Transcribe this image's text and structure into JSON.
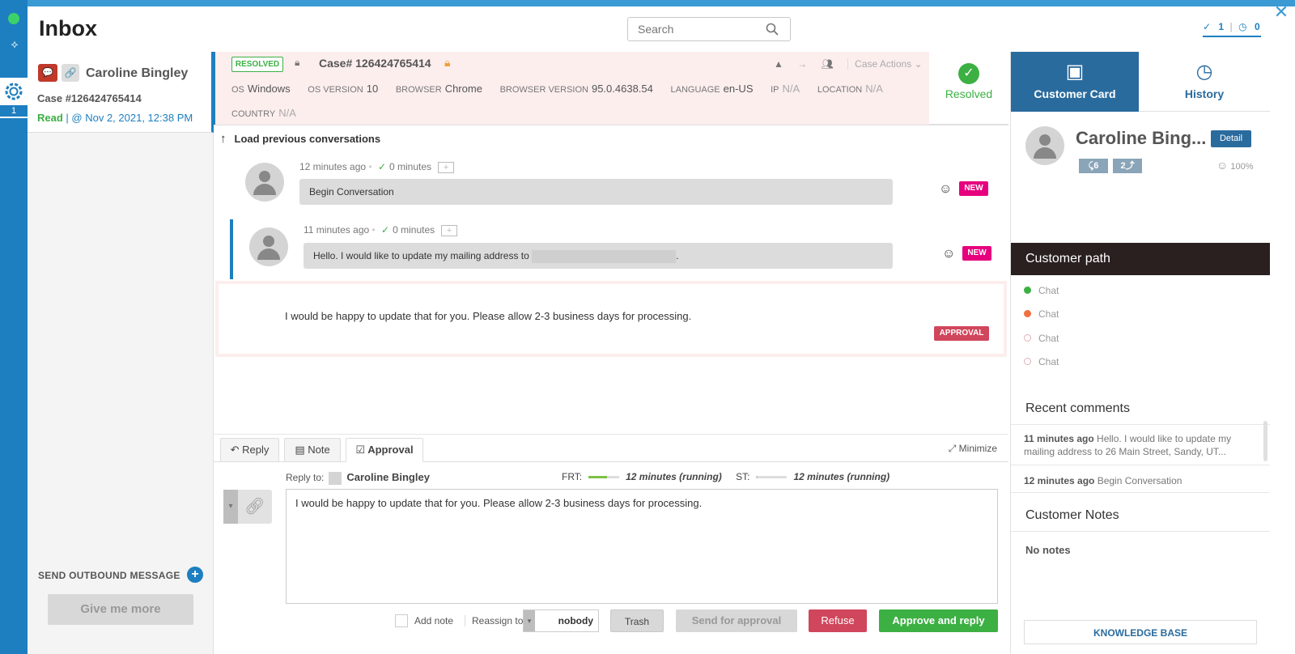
{
  "app": {
    "title": "Inbox",
    "close_glyph": "✕"
  },
  "rail": {
    "count": "1"
  },
  "search": {
    "placeholder": "Search"
  },
  "counters": {
    "resolved": "1",
    "pending": "0"
  },
  "case_card": {
    "name": "Caroline Bingley",
    "case": "Case #126424765414",
    "status": "Read",
    "timestamp": "| @ Nov 2, 2021, 12:38 PM"
  },
  "left": {
    "outbound": "SEND OUTBOUND MESSAGE",
    "give_more": "Give me more"
  },
  "case_header": {
    "status_badge": "RESOLVED",
    "case_number": "Case# 126424765414",
    "case_actions": "Case Actions",
    "meta": [
      {
        "k": "OS",
        "v": "Windows"
      },
      {
        "k": "OS VERSION",
        "v": "10"
      },
      {
        "k": "BROWSER",
        "v": "Chrome"
      },
      {
        "k": "BROWSER VERSION",
        "v": "95.0.4638.54"
      },
      {
        "k": "LANGUAGE",
        "v": "en-US"
      },
      {
        "k": "IP",
        "v": "N/A"
      },
      {
        "k": "LOCATION",
        "v": "N/A"
      },
      {
        "k": "COUNTRY",
        "v": "N/A"
      }
    ],
    "resolved_label": "Resolved"
  },
  "conversation": {
    "load_previous": "Load previous conversations",
    "messages": [
      {
        "time": "12 minutes ago",
        "response": "0 minutes",
        "text": "Begin Conversation",
        "badge": "NEW"
      },
      {
        "time": "11 minutes ago",
        "response": "0 minutes",
        "text": "Hello. I would like to update my mailing address to",
        "text_end": ".",
        "badge": "NEW"
      }
    ],
    "approval": {
      "text": "I would be happy to update that for you. Please allow 2-3 business days for processing.",
      "badge": "APPROVAL"
    }
  },
  "composer": {
    "tabs": [
      {
        "label": "Reply"
      },
      {
        "label": "Note"
      },
      {
        "label": "Approval"
      }
    ],
    "minimize": "Minimize",
    "reply_to_label": "Reply to:",
    "reply_to_name": "Caroline Bingley",
    "frt_label": "FRT:",
    "frt_value": "12 minutes (running)",
    "frt_progress": 0.6,
    "st_label": "ST:",
    "st_value": "12 minutes (running)",
    "st_progress": 0.05,
    "body": "I would be happy to update that for you. Please allow 2-3 business days for processing.",
    "add_note": "Add note",
    "reassign_to": "Reassign to",
    "assignee": "nobody",
    "trash": "Trash",
    "send_for_approval": "Send for approval",
    "refuse": "Refuse",
    "approve": "Approve and reply"
  },
  "right": {
    "tabs": [
      {
        "label": "Customer Card"
      },
      {
        "label": "History"
      }
    ],
    "customer_name": "Caroline Bing...",
    "detail": "Detail",
    "stat_in": "6",
    "stat_out": "2",
    "satisfaction": "100%",
    "path_title": "Customer path",
    "path": [
      {
        "label": "Chat",
        "color": "#3cb043"
      },
      {
        "label": "Chat",
        "color": "#f07040"
      },
      {
        "label": "Chat",
        "color": "#e0b0b8"
      },
      {
        "label": "Chat",
        "color": "#e0b0b8"
      }
    ],
    "recent_title": "Recent comments",
    "comments": [
      {
        "time": "11 minutes ago",
        "text": "Hello. I would like to update my mailing address to 26 Main Street, Sandy, UT..."
      },
      {
        "time": "12 minutes ago",
        "text": "Begin Conversation"
      }
    ],
    "notes_title": "Customer Notes",
    "no_notes": "No notes",
    "knowledge_base": "KNOWLEDGE BASE"
  },
  "colors": {
    "rail": "#1d7fbf",
    "accent": "#2a6b9e",
    "success": "#3cb043",
    "danger": "#d0465c",
    "new_badge": "#e6007e"
  }
}
